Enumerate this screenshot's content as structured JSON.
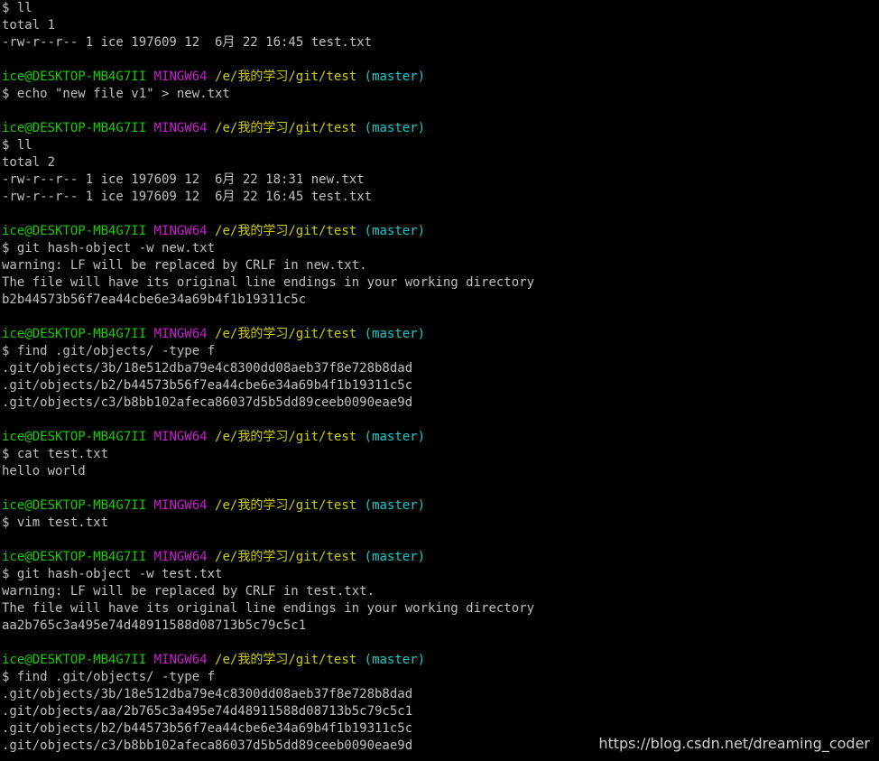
{
  "prompt_colors": {
    "user": "#19cb00",
    "host": "#cb1ed1",
    "path": "#cdcd00",
    "branch": "#0dcdcd",
    "text": "#c0c0c0",
    "background": "#000000"
  },
  "lines": [
    {
      "type": "cmd",
      "text": "$ ll"
    },
    {
      "type": "out",
      "text": "total 1"
    },
    {
      "type": "out",
      "text": "-rw-r--r-- 1 ice 197609 12  6月 22 16:45 test.txt"
    },
    {
      "type": "blank",
      "text": ""
    },
    {
      "type": "prompt",
      "user": "ice@DESKTOP-MB4G7II",
      "host": "MINGW64",
      "path": "/e/我的学习/git/test",
      "branch": "(master)"
    },
    {
      "type": "cmd",
      "text": "$ echo \"new file v1\" > new.txt"
    },
    {
      "type": "blank",
      "text": ""
    },
    {
      "type": "prompt",
      "user": "ice@DESKTOP-MB4G7II",
      "host": "MINGW64",
      "path": "/e/我的学习/git/test",
      "branch": "(master)"
    },
    {
      "type": "cmd",
      "text": "$ ll"
    },
    {
      "type": "out",
      "text": "total 2"
    },
    {
      "type": "out",
      "text": "-rw-r--r-- 1 ice 197609 12  6月 22 18:31 new.txt"
    },
    {
      "type": "out",
      "text": "-rw-r--r-- 1 ice 197609 12  6月 22 16:45 test.txt"
    },
    {
      "type": "blank",
      "text": ""
    },
    {
      "type": "prompt",
      "user": "ice@DESKTOP-MB4G7II",
      "host": "MINGW64",
      "path": "/e/我的学习/git/test",
      "branch": "(master)"
    },
    {
      "type": "cmd",
      "text": "$ git hash-object -w new.txt"
    },
    {
      "type": "out",
      "text": "warning: LF will be replaced by CRLF in new.txt."
    },
    {
      "type": "out",
      "text": "The file will have its original line endings in your working directory"
    },
    {
      "type": "out",
      "text": "b2b44573b56f7ea44cbe6e34a69b4f1b19311c5c"
    },
    {
      "type": "blank",
      "text": ""
    },
    {
      "type": "prompt",
      "user": "ice@DESKTOP-MB4G7II",
      "host": "MINGW64",
      "path": "/e/我的学习/git/test",
      "branch": "(master)"
    },
    {
      "type": "cmd",
      "text": "$ find .git/objects/ -type f"
    },
    {
      "type": "out",
      "text": ".git/objects/3b/18e512dba79e4c8300dd08aeb37f8e728b8dad"
    },
    {
      "type": "out",
      "text": ".git/objects/b2/b44573b56f7ea44cbe6e34a69b4f1b19311c5c"
    },
    {
      "type": "out",
      "text": ".git/objects/c3/b8bb102afeca86037d5b5dd89ceeb0090eae9d"
    },
    {
      "type": "blank",
      "text": ""
    },
    {
      "type": "prompt",
      "user": "ice@DESKTOP-MB4G7II",
      "host": "MINGW64",
      "path": "/e/我的学习/git/test",
      "branch": "(master)"
    },
    {
      "type": "cmd",
      "text": "$ cat test.txt"
    },
    {
      "type": "out",
      "text": "hello world"
    },
    {
      "type": "blank",
      "text": ""
    },
    {
      "type": "prompt",
      "user": "ice@DESKTOP-MB4G7II",
      "host": "MINGW64",
      "path": "/e/我的学习/git/test",
      "branch": "(master)"
    },
    {
      "type": "cmd",
      "text": "$ vim test.txt"
    },
    {
      "type": "blank",
      "text": ""
    },
    {
      "type": "prompt",
      "user": "ice@DESKTOP-MB4G7II",
      "host": "MINGW64",
      "path": "/e/我的学习/git/test",
      "branch": "(master)"
    },
    {
      "type": "cmd",
      "text": "$ git hash-object -w test.txt"
    },
    {
      "type": "out",
      "text": "warning: LF will be replaced by CRLF in test.txt."
    },
    {
      "type": "out",
      "text": "The file will have its original line endings in your working directory"
    },
    {
      "type": "out",
      "text": "aa2b765c3a495e74d48911588d08713b5c79c5c1"
    },
    {
      "type": "blank",
      "text": ""
    },
    {
      "type": "prompt",
      "user": "ice@DESKTOP-MB4G7II",
      "host": "MINGW64",
      "path": "/e/我的学习/git/test",
      "branch": "(master)"
    },
    {
      "type": "cmd",
      "text": "$ find .git/objects/ -type f"
    },
    {
      "type": "out",
      "text": ".git/objects/3b/18e512dba79e4c8300dd08aeb37f8e728b8dad"
    },
    {
      "type": "out",
      "text": ".git/objects/aa/2b765c3a495e74d48911588d08713b5c79c5c1"
    },
    {
      "type": "out",
      "text": ".git/objects/b2/b44573b56f7ea44cbe6e34a69b4f1b19311c5c"
    },
    {
      "type": "out",
      "text": ".git/objects/c3/b8bb102afeca86037d5b5dd89ceeb0090eae9d"
    }
  ],
  "watermark": "https://blog.csdn.net/dreaming_coder"
}
